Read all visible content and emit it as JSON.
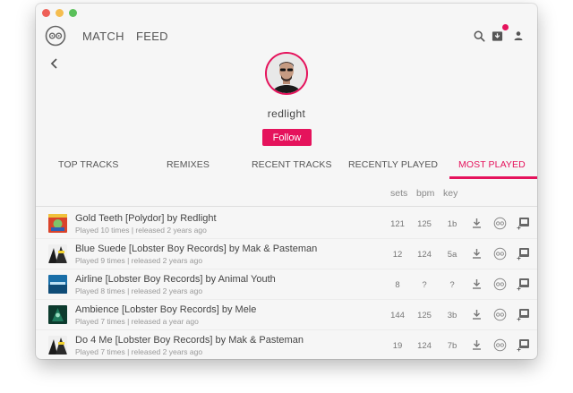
{
  "nav": {
    "match": "MATCH",
    "feed": "FEED"
  },
  "profile": {
    "username": "redlight",
    "follow_label": "Follow"
  },
  "tabs": [
    {
      "label": "TOP TRACKS"
    },
    {
      "label": "REMIXES"
    },
    {
      "label": "RECENT TRACKS"
    },
    {
      "label": "RECENTLY PLAYED"
    },
    {
      "label": "MOST PLAYED"
    }
  ],
  "active_tab": "MOST PLAYED",
  "columns": {
    "sets": "sets",
    "bpm": "bpm",
    "key": "key"
  },
  "tracks": [
    {
      "title": "Gold Teeth [Polydor] by Redlight",
      "subtitle": "Played 10 times | released 2 years ago",
      "sets": "121",
      "bpm": "125",
      "key": "1b"
    },
    {
      "title": "Blue Suede [Lobster Boy Records] by Mak & Pasteman",
      "subtitle": "Played 9 times | released 2 years ago",
      "sets": "12",
      "bpm": "124",
      "key": "5a"
    },
    {
      "title": "Airline [Lobster Boy Records] by Animal Youth",
      "subtitle": "Played 8 times | released 2 years ago",
      "sets": "8",
      "bpm": "?",
      "key": "?"
    },
    {
      "title": "Ambience [Lobster Boy Records] by Mele",
      "subtitle": "Played 7 times | released a year ago",
      "sets": "144",
      "bpm": "125",
      "key": "3b"
    },
    {
      "title": "Do 4 Me [Lobster Boy Records] by Mak & Pasteman",
      "subtitle": "Played 7 times | released 2 years ago",
      "sets": "19",
      "bpm": "124",
      "key": "7b"
    }
  ],
  "colors": {
    "accent": "#e5135c",
    "window_bg": "#f6f6f6"
  },
  "icons": [
    "logo-icon",
    "search-icon",
    "inbox-icon",
    "user-icon",
    "back-arrow-icon",
    "download-icon",
    "match-icon",
    "add-to-crate-icon"
  ]
}
